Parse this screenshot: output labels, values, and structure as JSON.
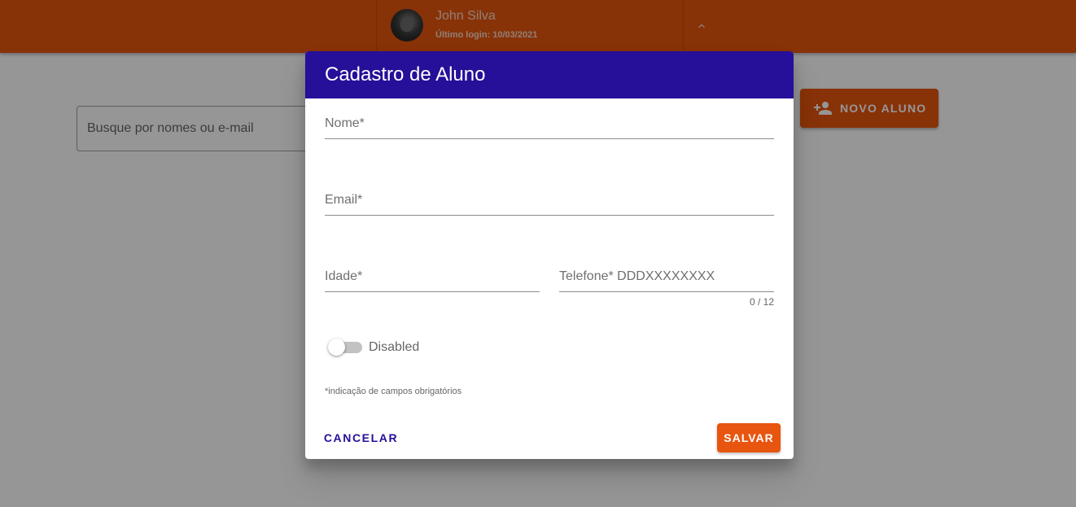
{
  "colors": {
    "accent": "#e8550f",
    "dialog_header": "#260f99",
    "overlay": "rgba(0,0,0,0.41)"
  },
  "header": {
    "user_name": "John Silva",
    "last_login": "Último login: 10/03/2021",
    "avatar_icon": "avatar",
    "expand_icon": "chevron-up-icon"
  },
  "page": {
    "search_placeholder": "Busque por nomes ou e-mail",
    "new_student_label": "NOVO ALUNO",
    "new_student_icon": "person-add-icon"
  },
  "dialog": {
    "title": "Cadastro de Aluno",
    "fields": {
      "nome_placeholder": "Nome*",
      "email_placeholder": "Email*",
      "idade_placeholder": "Idade*",
      "telefone_placeholder": "Telefone* DDDXXXXXXXX",
      "telefone_counter": "0 / 12"
    },
    "toggle_label": "Disabled",
    "required_note": "*indicação de campos obrigatórios",
    "cancel_label": "CANCELAR",
    "save_label": "SALVAR"
  }
}
